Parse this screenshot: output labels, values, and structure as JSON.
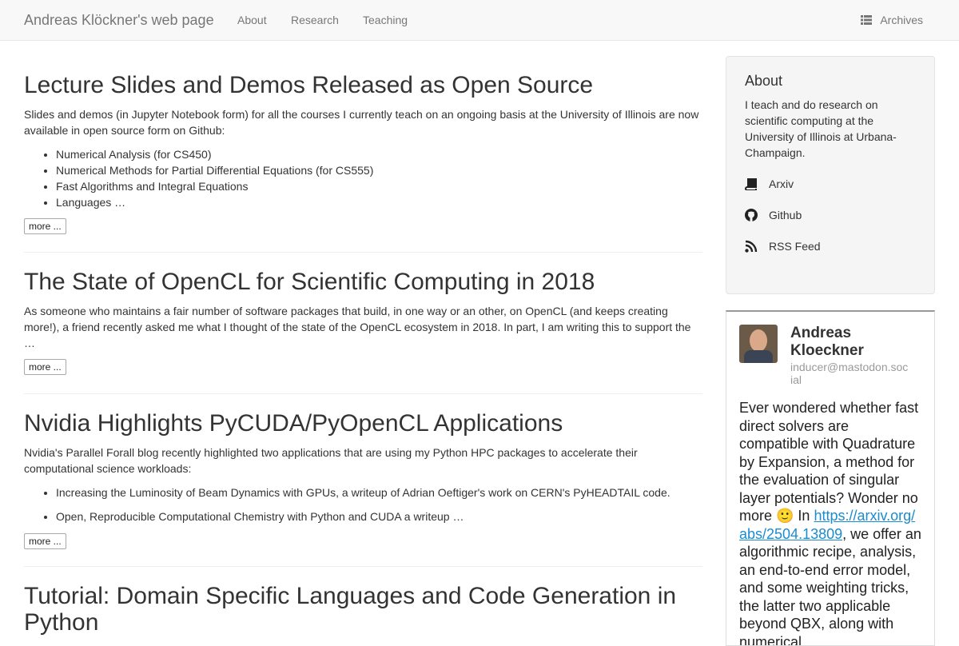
{
  "nav": {
    "brand": "Andreas Klöckner's web page",
    "links": [
      "About",
      "Research",
      "Teaching"
    ],
    "archives": "Archives"
  },
  "posts": [
    {
      "title": "Lecture Slides and Demos Released as Open Source",
      "summary": "Slides and demos (in Jupyter Notebook form) for all the courses I currently teach on an ongoing basis at the University of Illinois are now available in open source form on Github:",
      "items": [
        "Numerical Analysis (for CS450)",
        "Numerical Methods for Partial Differential Equations (for CS555)",
        "Fast Algorithms and Integral Equations",
        "Languages …"
      ],
      "more": "more ..."
    },
    {
      "title": "The State of OpenCL for Scientific Computing in 2018",
      "summary": "As someone who maintains a fair number of software packages that build, in one way or an other, on OpenCL (and keeps creating more!), a friend recently asked me what I thought of the state of the OpenCL ecosystem in 2018. In part, I am writing this to support the …",
      "more": "more ..."
    },
    {
      "title": "Nvidia Highlights PyCUDA/PyOpenCL Applications",
      "summary": "Nvidia's Parallel Forall blog recently highlighted two applications that are using my Python HPC packages to accelerate their computational science workloads:",
      "items": [
        "Increasing the Luminosity of Beam Dynamics with GPUs, a writeup of Adrian Oeftiger's work on CERN's PyHEADTAIL code.",
        "Open, Reproducible Computational Chemistry with Python and CUDA a writeup …"
      ],
      "more": "more ..."
    },
    {
      "title": "Tutorial: Domain Specific Languages and Code Generation in Python"
    }
  ],
  "aside": {
    "title": "About",
    "text": "I teach and do research on scientific computing at the University of Illinois at Urbana-Champaign.",
    "links": [
      {
        "label": "Arxiv",
        "icon": "book-icon"
      },
      {
        "label": "Github",
        "icon": "github-icon"
      },
      {
        "label": "RSS Feed",
        "icon": "rss-icon"
      }
    ]
  },
  "mastodon": {
    "name": "Andreas Kloeckner",
    "handle": "inducer@mastodon.social",
    "toot_before": "Ever wondered whether fast direct solvers are compatible with Quadrature by Expansion, a method for the evaluation of singular layer potentials? Wonder no more 🙂 In ",
    "toot_link": "https://arxiv.org/abs/2504.13809",
    "toot_after": ", we offer an algorithmic recipe, analysis, an end-to-end error model, and some weighting tricks, the latter two applicable beyond QBX, along with numerical"
  },
  "colors": {
    "navbar_bg": "#f8f8f8",
    "nav_text": "#777777",
    "sidebar_bg": "#f5f5f5",
    "link": "#1a8ccf"
  }
}
